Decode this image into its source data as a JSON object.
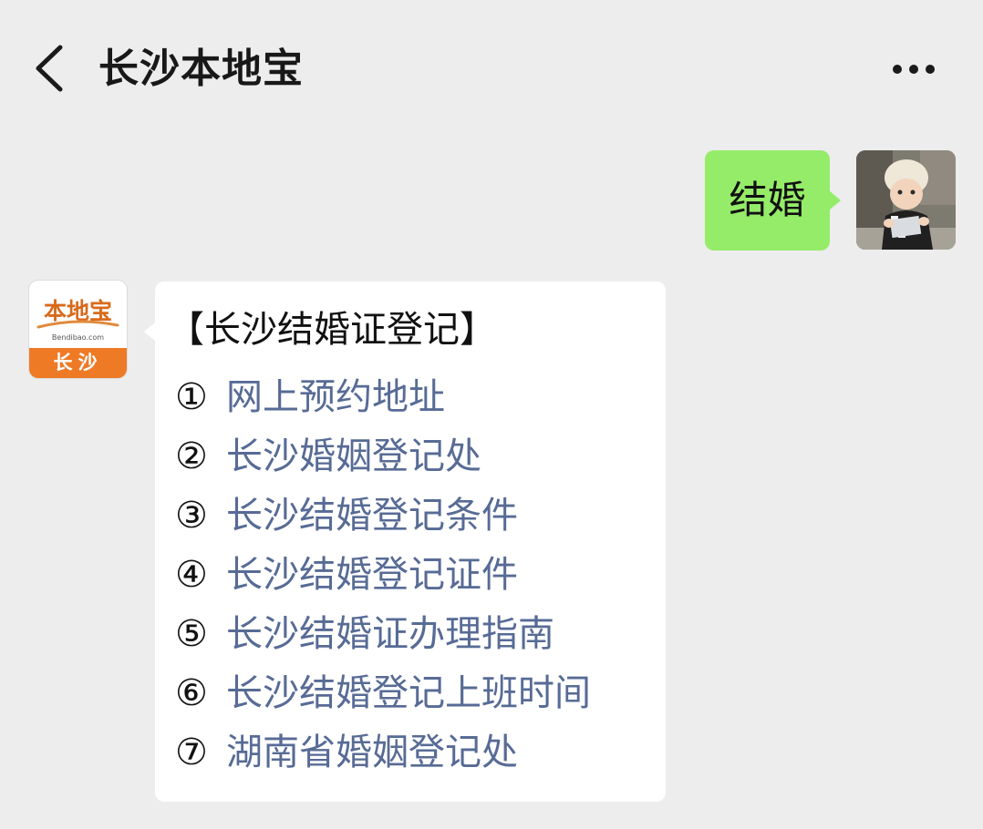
{
  "header": {
    "title": "长沙本地宝",
    "back_icon": "chevron-left-icon",
    "more_icon": "more-dots-icon"
  },
  "outgoing": {
    "text": "结婚",
    "bubble_color": "#95ec69"
  },
  "incoming": {
    "avatar": {
      "logo_text": "本地宝",
      "logo_domain": "Bendibao.com",
      "city": "长沙",
      "accent_color": "#ee7a26"
    },
    "heading": "【长沙结婚证登记】",
    "links": [
      {
        "num": "①",
        "text": "网上预约地址"
      },
      {
        "num": "②",
        "text": "长沙婚姻登记处"
      },
      {
        "num": "③",
        "text": "长沙结婚登记条件"
      },
      {
        "num": "④",
        "text": "长沙结婚登记证件"
      },
      {
        "num": "⑤",
        "text": "长沙结婚证办理指南"
      },
      {
        "num": "⑥",
        "text": "长沙结婚登记上班时间"
      },
      {
        "num": "⑦",
        "text": "湖南省婚姻登记处"
      }
    ],
    "link_color": "#576b95"
  }
}
